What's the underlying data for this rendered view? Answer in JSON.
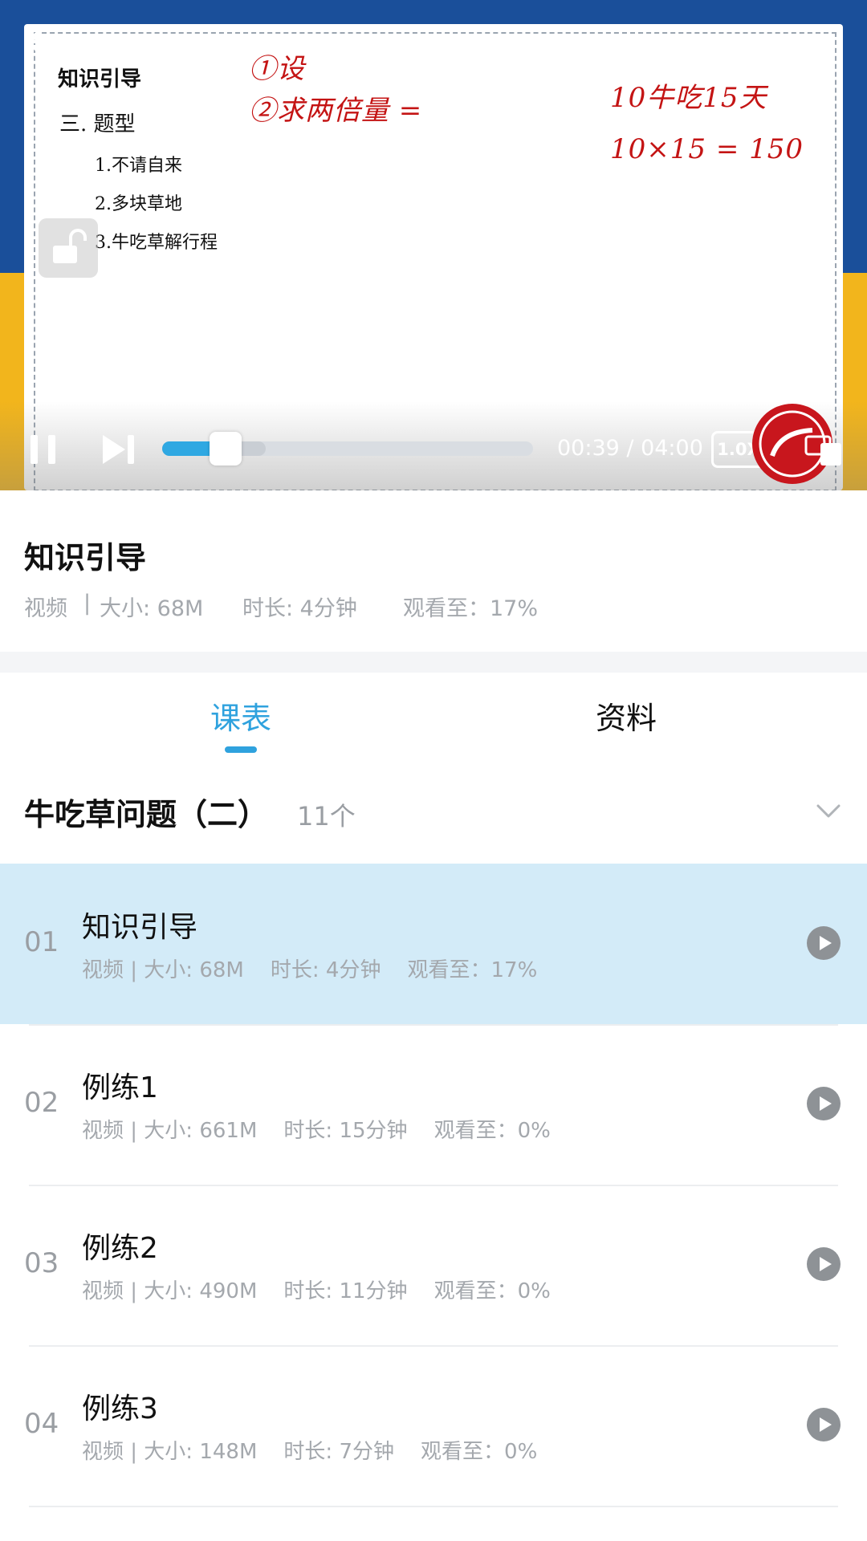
{
  "player": {
    "whiteboard": {
      "title": "知识引导",
      "section": "三.  题型",
      "items": [
        "1.不请自来",
        "2.多块草地",
        "3.牛吃草解行程"
      ],
      "handwriting": [
        "①设",
        "②求两倍量 =",
        "10牛吃15天",
        "10×15 = 150"
      ]
    },
    "time": "00:39 / 04:00",
    "progress_percent": 17,
    "buffered_percent": 28,
    "speed": "1.0X"
  },
  "lesson": {
    "title": "知识引导",
    "type": "视频",
    "size": "大小: 68M",
    "duration": "时长: 4分钟",
    "watched": "观看至：17%"
  },
  "tabs": [
    {
      "label": "课表",
      "active": true
    },
    {
      "label": "资料",
      "active": false
    }
  ],
  "chapter": {
    "title": "牛吃草问题（二）",
    "count": "11个"
  },
  "items": [
    {
      "num": "01",
      "title": "知识引导",
      "meta": "视频 | 大小: 68M    时长: 4分钟    观看至：17%",
      "active": true
    },
    {
      "num": "02",
      "title": "例练1",
      "meta": "视频 | 大小: 661M    时长: 15分钟    观看至：0%",
      "active": false
    },
    {
      "num": "03",
      "title": "例练2",
      "meta": "视频 | 大小: 490M    时长: 11分钟    观看至：0%",
      "active": false
    },
    {
      "num": "04",
      "title": "例练3",
      "meta": "视频 | 大小: 148M    时长: 7分钟    观看至：0%",
      "active": false
    }
  ],
  "colors": {
    "accent": "#2fa2de",
    "active_row": "#d3ebf8",
    "meta_text": "#a4a8ad",
    "handwriting": "#c41414"
  },
  "icons": [
    "back-arrow-icon",
    "unlock-icon",
    "pause-icon",
    "skip-next-icon",
    "fullscreen-icon",
    "chevron-down-icon",
    "play-circle-icon"
  ]
}
